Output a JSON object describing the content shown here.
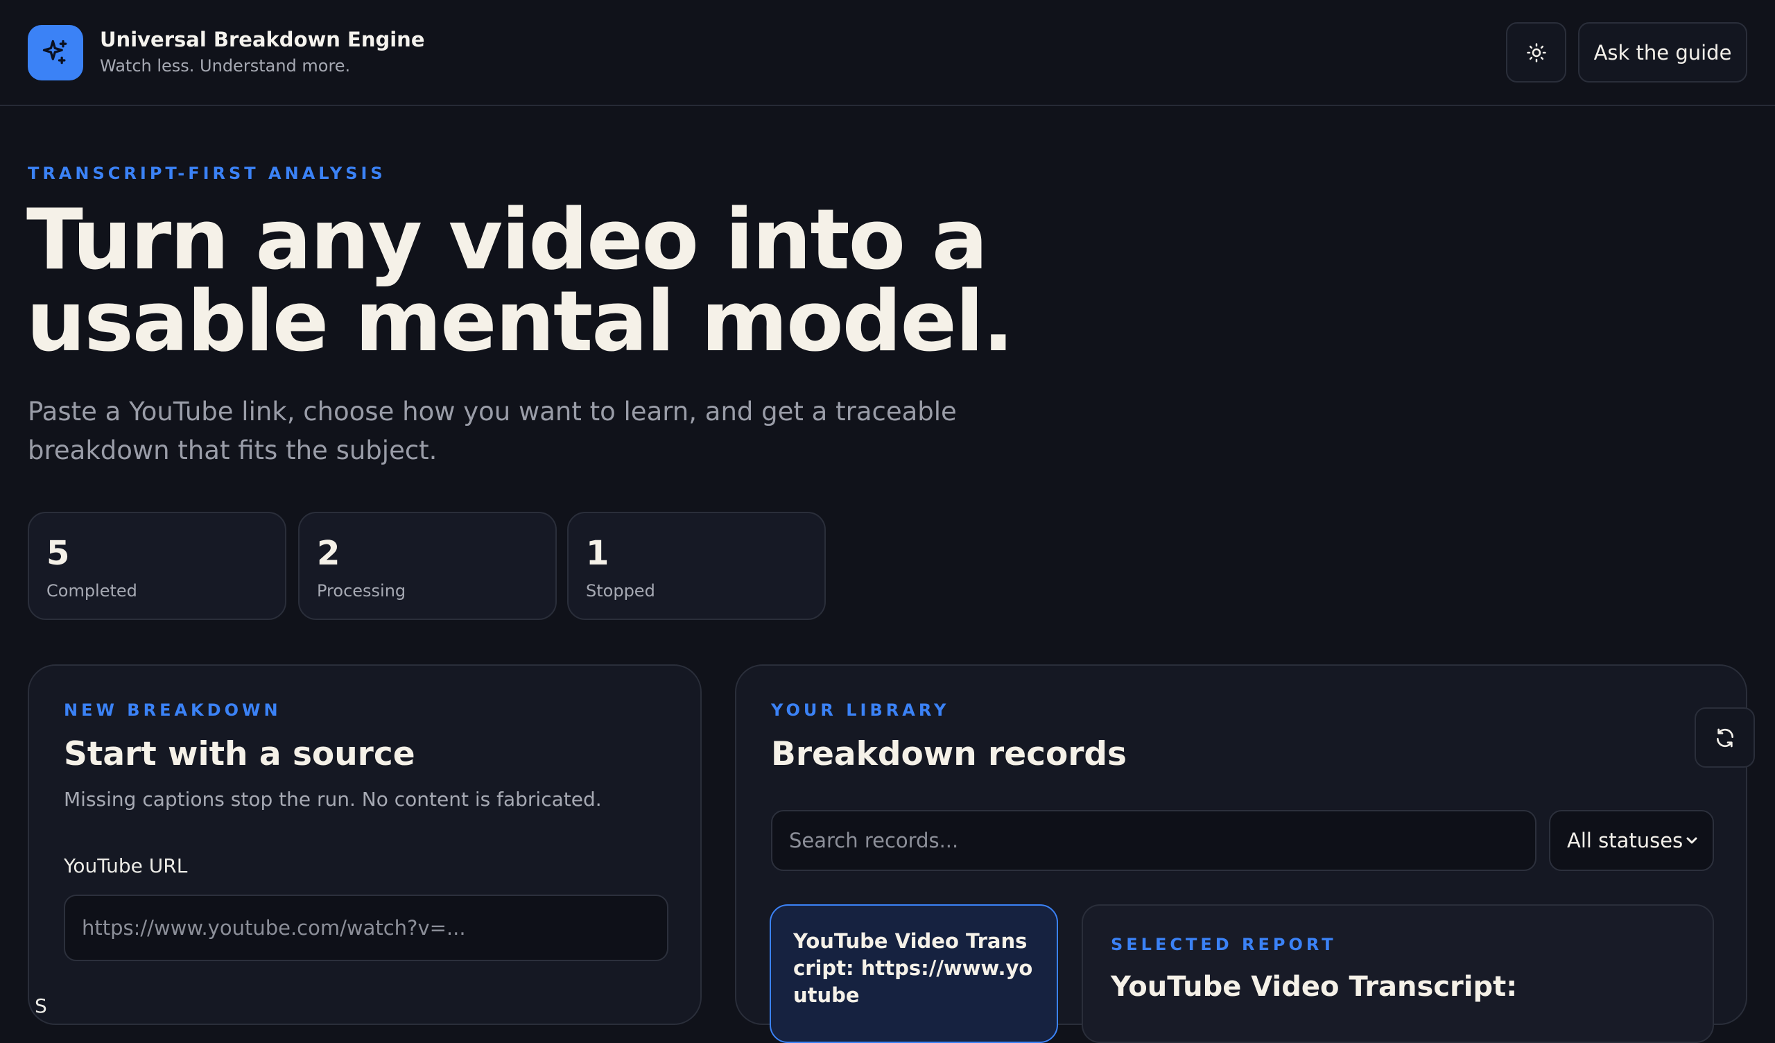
{
  "app": {
    "title": "Universal Breakdown Engine",
    "tagline": "Watch less. Understand more.",
    "guide_button": "Ask the guide",
    "theme_toggle_icon": "sun-icon",
    "logo_icon": "sparkles-icon"
  },
  "hero": {
    "eyebrow": "TRANSCRIPT-FIRST ANALYSIS",
    "title": "Turn any video into a usable mental model.",
    "description": "Paste a YouTube link, choose how you want to learn, and get a traceable breakdown that fits the subject."
  },
  "stats": [
    {
      "value": "5",
      "label": "Completed"
    },
    {
      "value": "2",
      "label": "Processing"
    },
    {
      "value": "1",
      "label": "Stopped"
    }
  ],
  "new_breakdown": {
    "eyebrow": "NEW BREAKDOWN",
    "title": "Start with a source",
    "note": "Missing captions stop the run. No content is fabricated.",
    "url_label": "YouTube URL",
    "url_placeholder": "https://www.youtube.com/watch?v=...",
    "url_value": "",
    "next_label_partial": "S"
  },
  "library": {
    "eyebrow": "YOUR LIBRARY",
    "title": "Breakdown records",
    "refresh_icon": "refresh-icon",
    "search_placeholder": "Search records...",
    "search_value": "",
    "status_filter": "All statuses",
    "records": [
      {
        "title": "YouTube Video Transcript: https://www.youtube"
      }
    ],
    "selected_report": {
      "eyebrow": "SELECTED REPORT",
      "title": "YouTube Video Transcript:"
    }
  },
  "colors": {
    "background": "#10121a",
    "accent": "#3b82f6",
    "panel": "#151823",
    "border": "#2a2e3a",
    "text": "#f5f1e8",
    "muted": "#a6a9b3"
  }
}
